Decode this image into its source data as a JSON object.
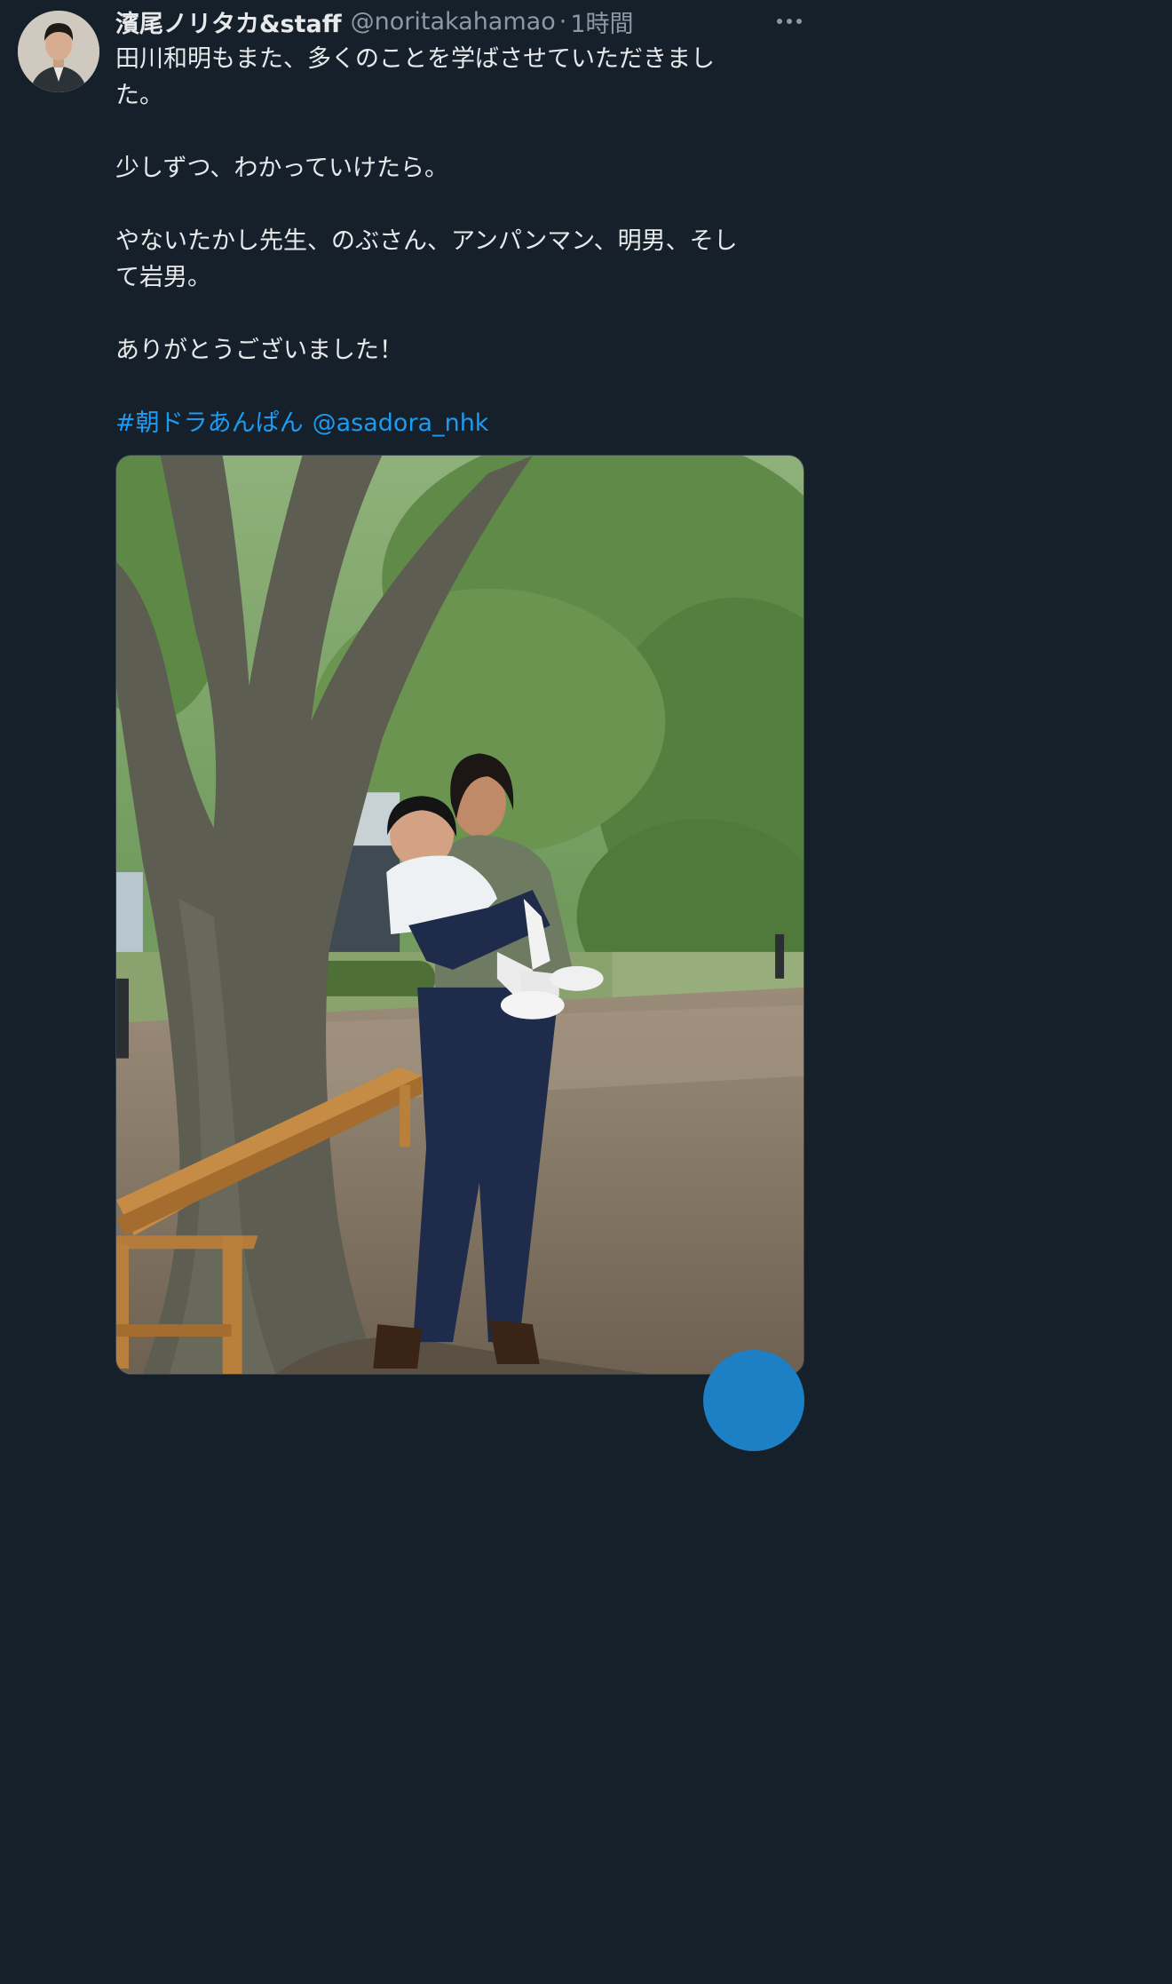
{
  "tweet": {
    "author_name": "濱尾ノリタカ&staff",
    "handle": "@noritakahamao",
    "separator": "·",
    "time": "1時間",
    "lines": [
      "田川和明もまた、多くのことを学ばさせていただきまし",
      "た。",
      "",
      "少しずつ、わかっていけたら。",
      "",
      "やないたかし先生、のぶさん、アンパンマン、明男、そし",
      "て岩男。",
      "",
      "ありがとうございました！",
      ""
    ],
    "hashtag": "#朝ドラあんぱん",
    "mention": "@asadora_nhk"
  },
  "icons": {
    "more": "more-horizontal-icon",
    "compose": "compose-fab"
  },
  "colors": {
    "background": "#15202b",
    "text": "#e7e9ea",
    "secondary": "#8b98a5",
    "link": "#1d9bf0"
  }
}
